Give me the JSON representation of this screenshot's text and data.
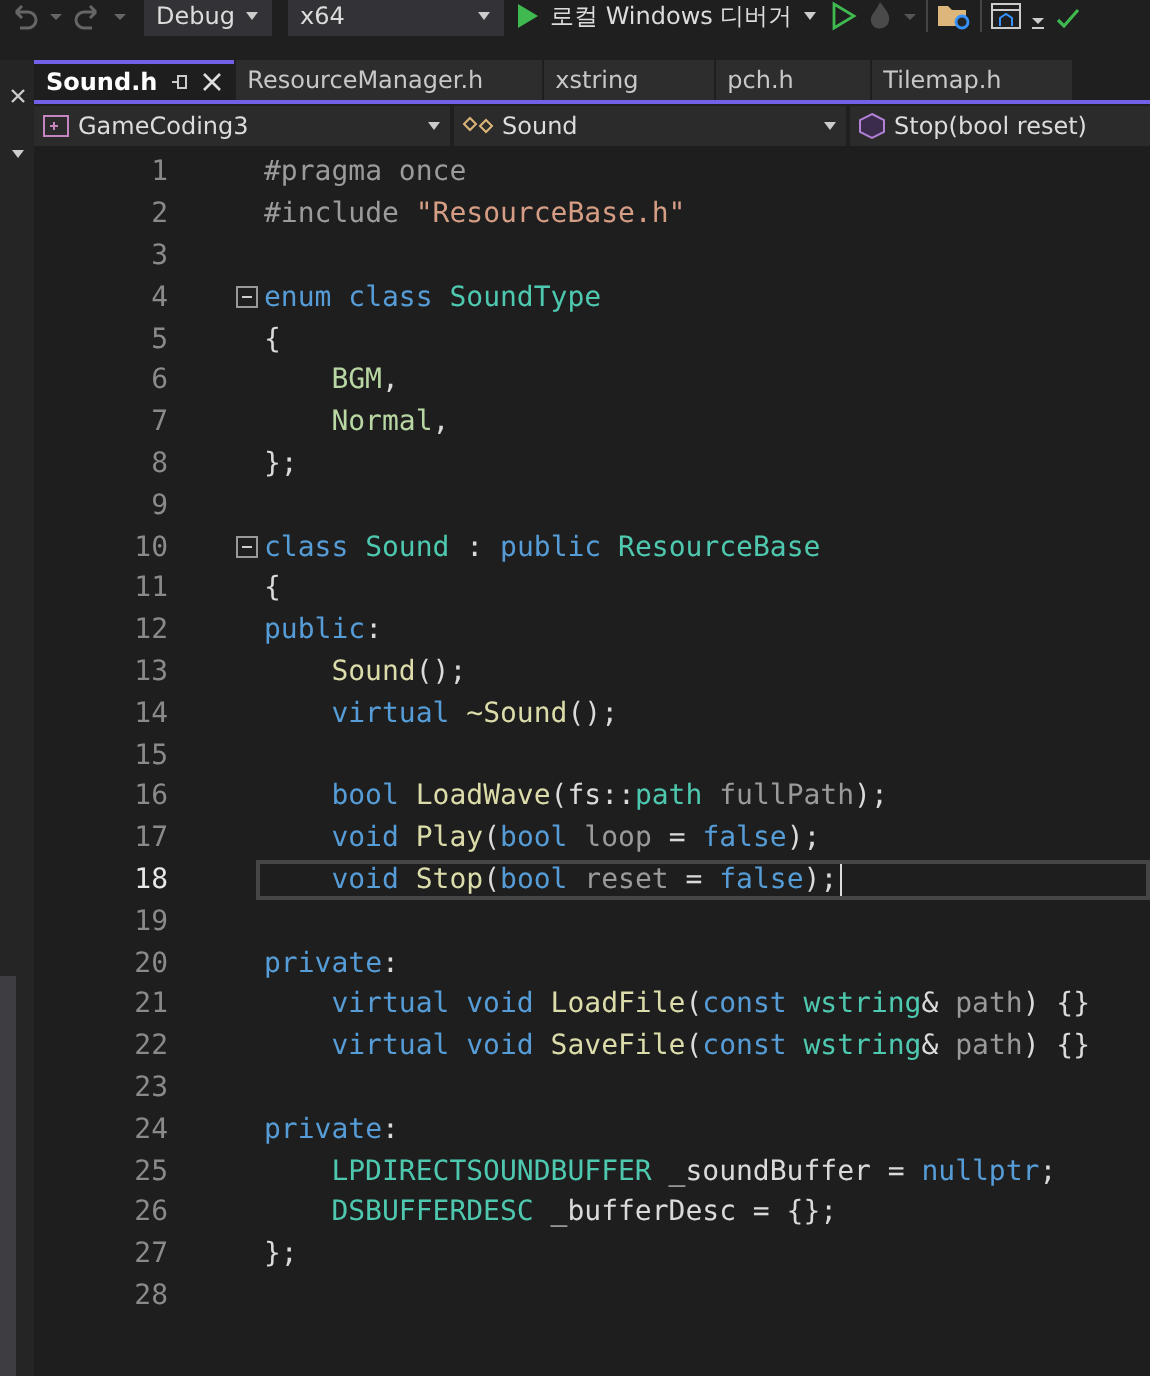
{
  "toolbar": {
    "configuration": "Debug",
    "platform": "x64",
    "debugger": "로컬 Windows 디버거"
  },
  "tabs": [
    {
      "label": "Sound.h",
      "selected": true
    },
    {
      "label": "ResourceManager.h",
      "selected": false
    },
    {
      "label": "xstring",
      "selected": false
    },
    {
      "label": "pch.h",
      "selected": false
    },
    {
      "label": "Tilemap.h",
      "selected": false
    }
  ],
  "navigation": {
    "project": "GameCoding3",
    "scope": "Sound",
    "member": "Stop(bool reset)"
  },
  "lines": [
    {
      "number": "1",
      "foldable": false,
      "selected": false,
      "indented": false,
      "tokens": [
        {
          "text": "#pragma once",
          "kind": "preproc"
        }
      ]
    },
    {
      "number": "2",
      "foldable": false,
      "selected": false,
      "indented": false,
      "tokens": [
        {
          "text": "#include ",
          "kind": "preproc"
        },
        {
          "text": "\"ResourceBase.h\"",
          "kind": "string"
        }
      ]
    },
    {
      "number": "3",
      "foldable": false,
      "selected": false
    },
    {
      "number": "4",
      "foldable": true,
      "selected": false,
      "indented": false,
      "tokens": [
        {
          "text": "enum class ",
          "kind": "keyword"
        },
        {
          "text": "SoundType",
          "kind": "type"
        }
      ]
    },
    {
      "number": "5",
      "foldable": false,
      "selected": false,
      "indented": false,
      "tokens": [
        {
          "text": "{",
          "kind": "plain"
        }
      ]
    },
    {
      "number": "6",
      "foldable": false,
      "selected": false,
      "indented": true,
      "tokens": [
        {
          "text": "BGM",
          "kind": "enum"
        },
        {
          "text": ",",
          "kind": "plain"
        }
      ]
    },
    {
      "number": "7",
      "foldable": false,
      "selected": false,
      "indented": true,
      "tokens": [
        {
          "text": "Normal",
          "kind": "enum"
        },
        {
          "text": ",",
          "kind": "plain"
        }
      ]
    },
    {
      "number": "8",
      "foldable": false,
      "selected": false,
      "indented": false,
      "tokens": [
        {
          "text": "};",
          "kind": "plain"
        }
      ]
    },
    {
      "number": "9",
      "foldable": false,
      "selected": false
    },
    {
      "number": "10",
      "foldable": true,
      "selected": false,
      "indented": false,
      "tokens": [
        {
          "text": "class ",
          "kind": "keyword"
        },
        {
          "text": "Sound",
          "kind": "type"
        },
        {
          "text": " : ",
          "kind": "plain"
        },
        {
          "text": "public ",
          "kind": "keyword"
        },
        {
          "text": "ResourceBase",
          "kind": "type"
        }
      ]
    },
    {
      "number": "11",
      "foldable": false,
      "selected": false,
      "indented": false,
      "tokens": [
        {
          "text": "{",
          "kind": "plain"
        }
      ]
    },
    {
      "number": "12",
      "foldable": false,
      "selected": false,
      "indented": false,
      "tokens": [
        {
          "text": "public",
          "kind": "keyword"
        },
        {
          "text": ":",
          "kind": "plain"
        }
      ]
    },
    {
      "number": "13",
      "foldable": false,
      "selected": false,
      "indented": true,
      "tokens": [
        {
          "text": "Sound",
          "kind": "func"
        },
        {
          "text": "();",
          "kind": "plain"
        }
      ]
    },
    {
      "number": "14",
      "foldable": false,
      "selected": false,
      "indented": true,
      "tokens": [
        {
          "text": "virtual ",
          "kind": "keyword"
        },
        {
          "text": "~Sound",
          "kind": "func"
        },
        {
          "text": "();",
          "kind": "plain"
        }
      ]
    },
    {
      "number": "15",
      "foldable": false,
      "selected": false
    },
    {
      "number": "16",
      "foldable": false,
      "selected": false,
      "indented": true,
      "tokens": [
        {
          "text": "bool ",
          "kind": "keyword"
        },
        {
          "text": "LoadWave",
          "kind": "func"
        },
        {
          "text": "(fs::",
          "kind": "plain"
        },
        {
          "text": "path ",
          "kind": "type"
        },
        {
          "text": "fullPath",
          "kind": "param"
        },
        {
          "text": ");",
          "kind": "plain"
        }
      ]
    },
    {
      "number": "17",
      "foldable": false,
      "selected": false,
      "indented": true,
      "tokens": [
        {
          "text": "void ",
          "kind": "keyword"
        },
        {
          "text": "Play",
          "kind": "func"
        },
        {
          "text": "(",
          "kind": "plain"
        },
        {
          "text": "bool ",
          "kind": "keyword"
        },
        {
          "text": "loop",
          "kind": "param"
        },
        {
          "text": " = ",
          "kind": "plain"
        },
        {
          "text": "false",
          "kind": "keyword"
        },
        {
          "text": ");",
          "kind": "plain"
        }
      ]
    },
    {
      "number": "18",
      "foldable": false,
      "selected": true,
      "indented": true,
      "tokens": [
        {
          "text": "void ",
          "kind": "keyword"
        },
        {
          "text": "Stop",
          "kind": "func"
        },
        {
          "text": "(",
          "kind": "plain"
        },
        {
          "text": "bool ",
          "kind": "keyword"
        },
        {
          "text": "reset",
          "kind": "param"
        },
        {
          "text": " = ",
          "kind": "plain"
        },
        {
          "text": "false",
          "kind": "keyword"
        },
        {
          "text": ");",
          "kind": "plain"
        }
      ]
    },
    {
      "number": "19",
      "foldable": false,
      "selected": false
    },
    {
      "number": "20",
      "foldable": false,
      "selected": false,
      "indented": false,
      "tokens": [
        {
          "text": "private",
          "kind": "keyword"
        },
        {
          "text": ":",
          "kind": "plain"
        }
      ]
    },
    {
      "number": "21",
      "foldable": false,
      "selected": false,
      "indented": true,
      "tokens": [
        {
          "text": "virtual void ",
          "kind": "keyword"
        },
        {
          "text": "LoadFile",
          "kind": "func"
        },
        {
          "text": "(",
          "kind": "plain"
        },
        {
          "text": "const ",
          "kind": "keyword"
        },
        {
          "text": "wstring",
          "kind": "type"
        },
        {
          "text": "& ",
          "kind": "plain"
        },
        {
          "text": "path",
          "kind": "param"
        },
        {
          "text": ") {}",
          "kind": "plain"
        }
      ]
    },
    {
      "number": "22",
      "foldable": false,
      "selected": false,
      "indented": true,
      "tokens": [
        {
          "text": "virtual void ",
          "kind": "keyword"
        },
        {
          "text": "SaveFile",
          "kind": "func"
        },
        {
          "text": "(",
          "kind": "plain"
        },
        {
          "text": "const ",
          "kind": "keyword"
        },
        {
          "text": "wstring",
          "kind": "type"
        },
        {
          "text": "& ",
          "kind": "plain"
        },
        {
          "text": "path",
          "kind": "param"
        },
        {
          "text": ") {}",
          "kind": "plain"
        }
      ]
    },
    {
      "number": "23",
      "foldable": false,
      "selected": false
    },
    {
      "number": "24",
      "foldable": false,
      "selected": false,
      "indented": false,
      "tokens": [
        {
          "text": "private",
          "kind": "keyword"
        },
        {
          "text": ":",
          "kind": "plain"
        }
      ]
    },
    {
      "number": "25",
      "foldable": false,
      "selected": false,
      "indented": true,
      "tokens": [
        {
          "text": "LPDIRECTSOUNDBUFFER",
          "kind": "type"
        },
        {
          "text": " _soundBuffer = ",
          "kind": "plain"
        },
        {
          "text": "nullptr",
          "kind": "keyword"
        },
        {
          "text": ";",
          "kind": "plain"
        }
      ]
    },
    {
      "number": "26",
      "foldable": false,
      "selected": false,
      "indented": true,
      "tokens": [
        {
          "text": "DSBUFFERDESC",
          "kind": "type"
        },
        {
          "text": " _bufferDesc = {};",
          "kind": "plain"
        }
      ]
    },
    {
      "number": "27",
      "foldable": false,
      "selected": false,
      "indented": false,
      "tokens": [
        {
          "text": "};",
          "kind": "plain"
        }
      ]
    },
    {
      "number": "28",
      "foldable": false,
      "selected": false
    }
  ]
}
